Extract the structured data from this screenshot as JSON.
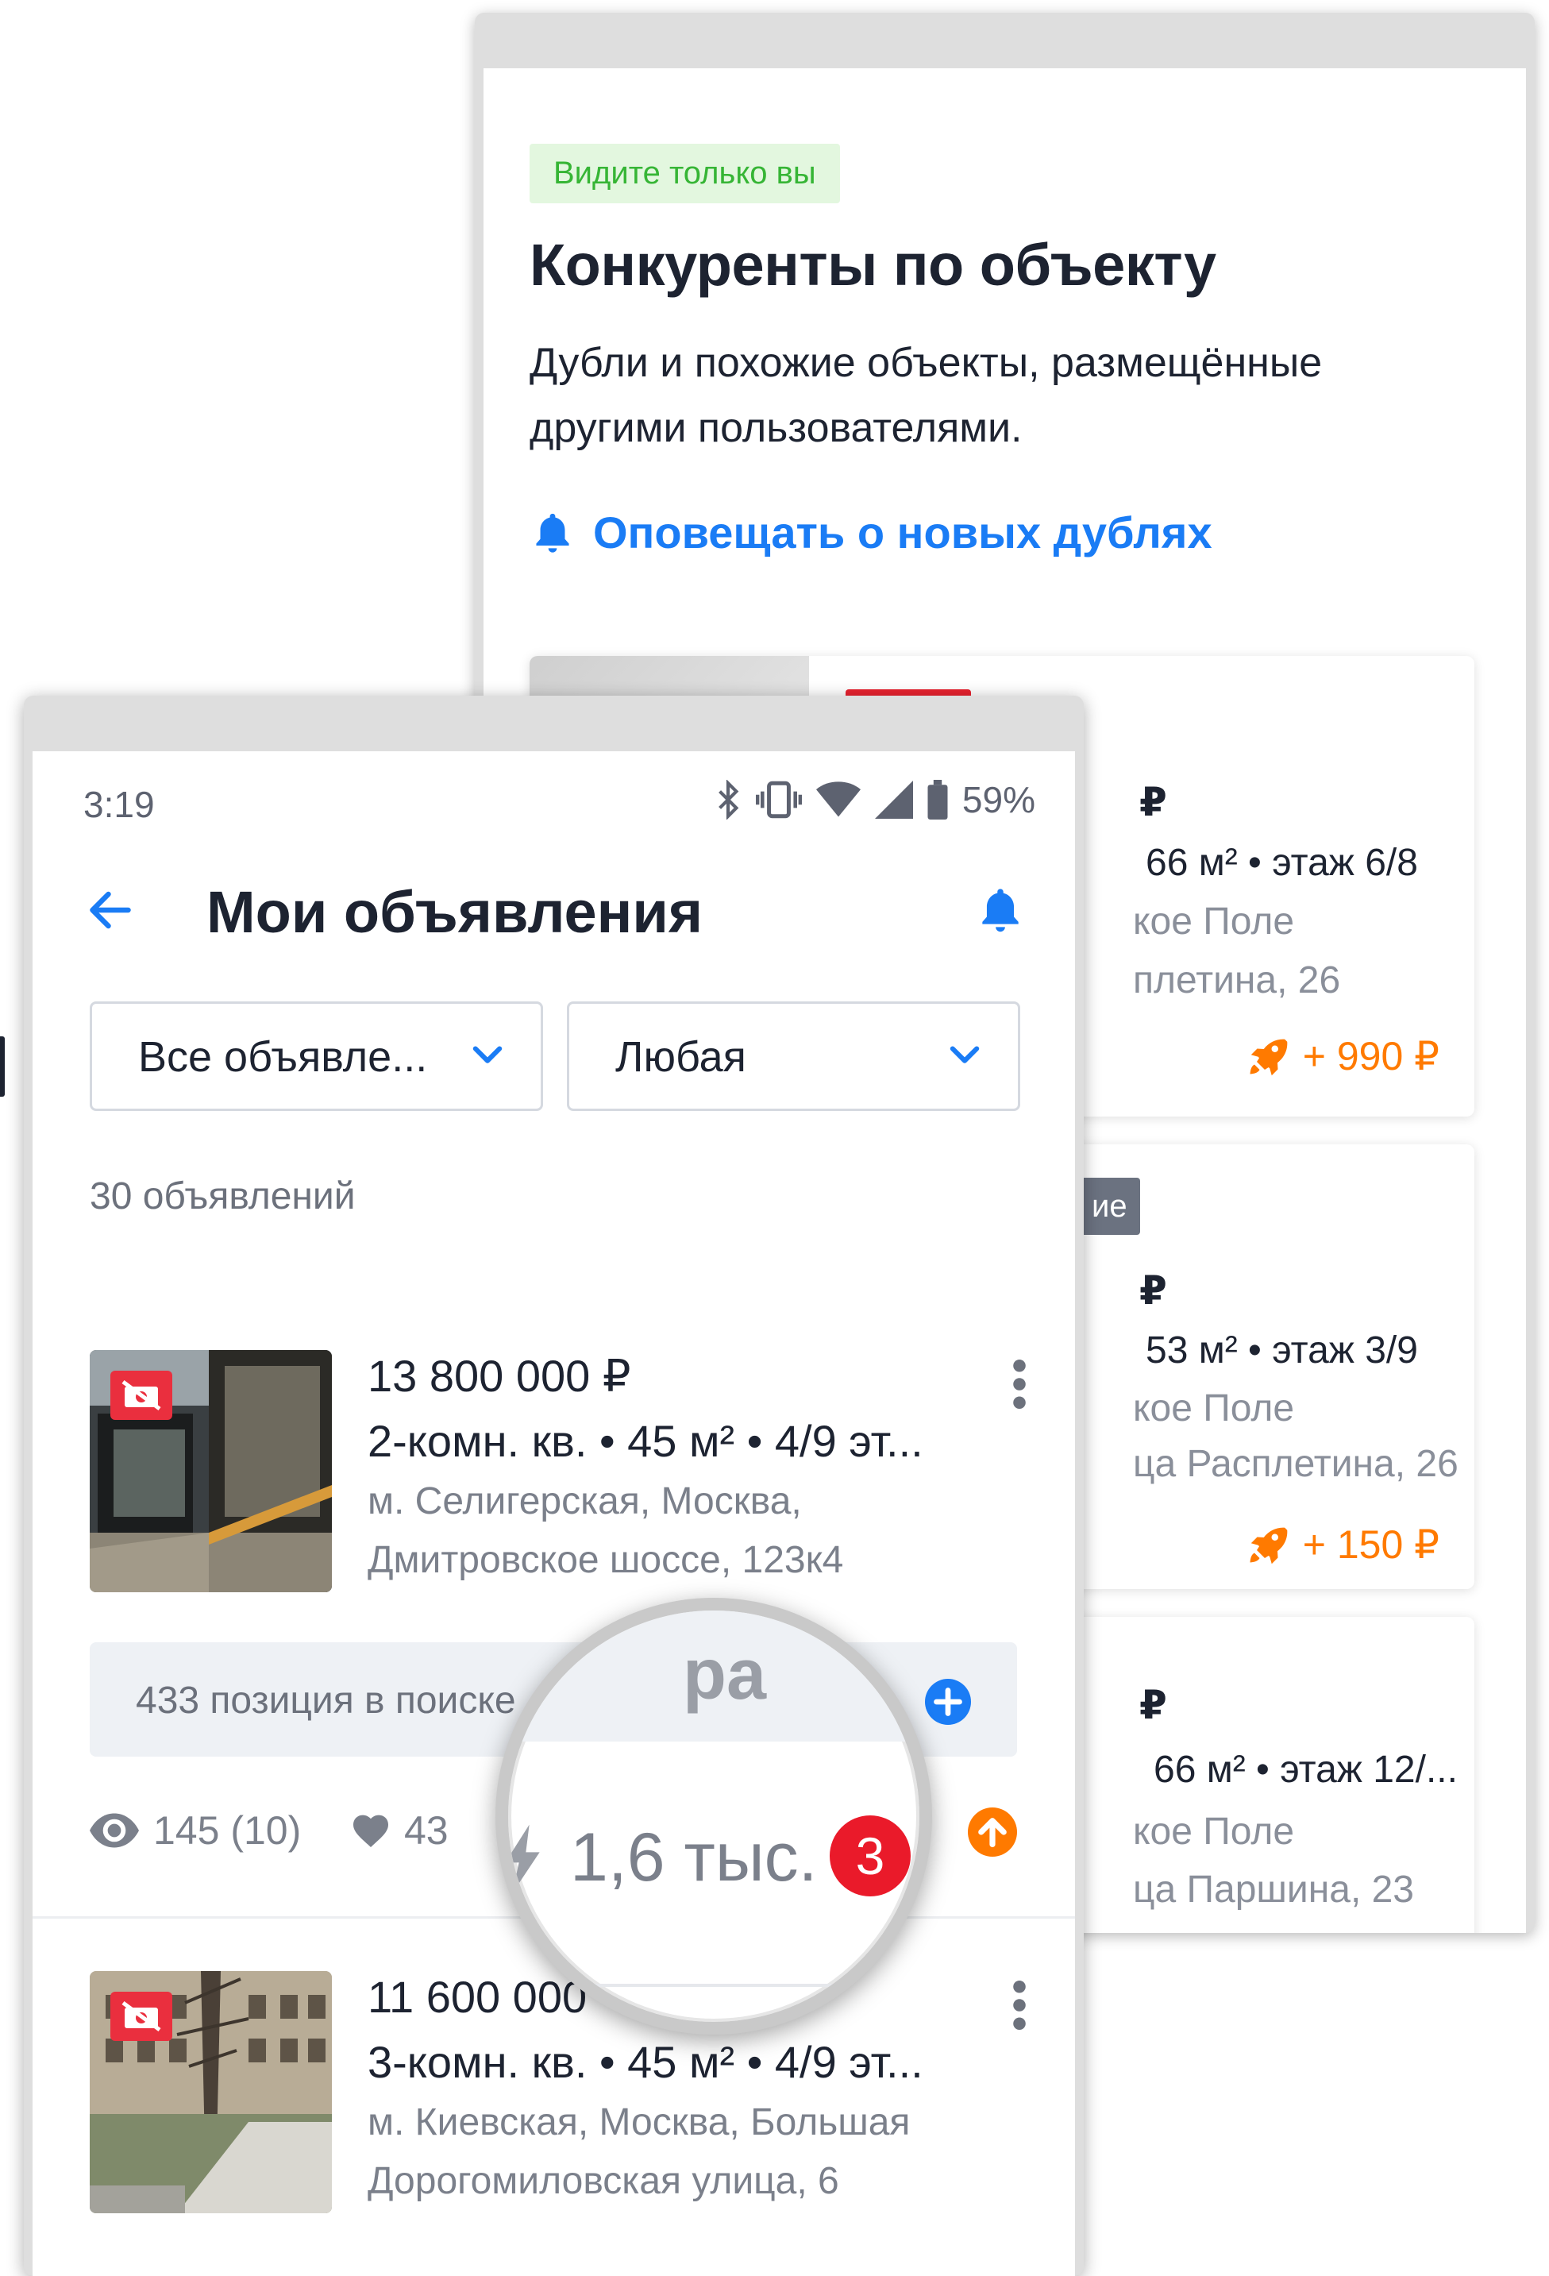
{
  "back_screen": {
    "badge": "Видите только вы",
    "title": "Конкуренты по объекту",
    "description": "Дубли и похожие объекты, размещённые другими пользователями.",
    "notify_link": "Оповещать о новых дублях",
    "cards": [
      {
        "price": "₽",
        "params": "66 м² • этаж 6/8",
        "addr1": "кое Поле",
        "addr2": "плетина, 26",
        "promo": "+ 990 ₽"
      },
      {
        "tag": "ие",
        "price": "₽",
        "params": "53 м² • этаж 3/9",
        "addr1": "кое Поле",
        "addr2": "ца Расплетина, 26",
        "promo": "+ 150 ₽"
      },
      {
        "price": "₽",
        "params": "66 м² • этаж 12/...",
        "addr1": "кое Поле",
        "addr2": "ца Паршина, 23"
      }
    ]
  },
  "status_bar": {
    "time": "3:19",
    "battery": "59%"
  },
  "app_bar": {
    "title": "Мои объявления"
  },
  "filters": {
    "type": "Все объявле...",
    "period": "Любая"
  },
  "count": "30 объявлений",
  "listings": [
    {
      "price": "13 800 000 ₽",
      "params": "2-комн. кв. • 45 м² • 4/9 эт...",
      "addr1": "м. Селигерская, Москва,",
      "addr2": "Дмитровское шоссе, 123к4",
      "search_position": "433 позиция в поиске",
      "views": "145 (10)",
      "favorites": "43"
    },
    {
      "price": "11 600 000",
      "params": "3-комн. кв. • 45 м² • 4/9 эт...",
      "addr1": "м. Киевская, Москва, Большая",
      "addr2": "Дорогомиловская улица, 6"
    }
  ],
  "magnifier": {
    "top_text": "ра",
    "value": "1,6 тыс.",
    "badge": "3"
  },
  "colors": {
    "accent": "#1a7cf5",
    "promo": "#ff7a00",
    "badge_red": "#ea1a2a",
    "green_badge_bg": "#e3f7df",
    "green_badge_text": "#36b535"
  }
}
